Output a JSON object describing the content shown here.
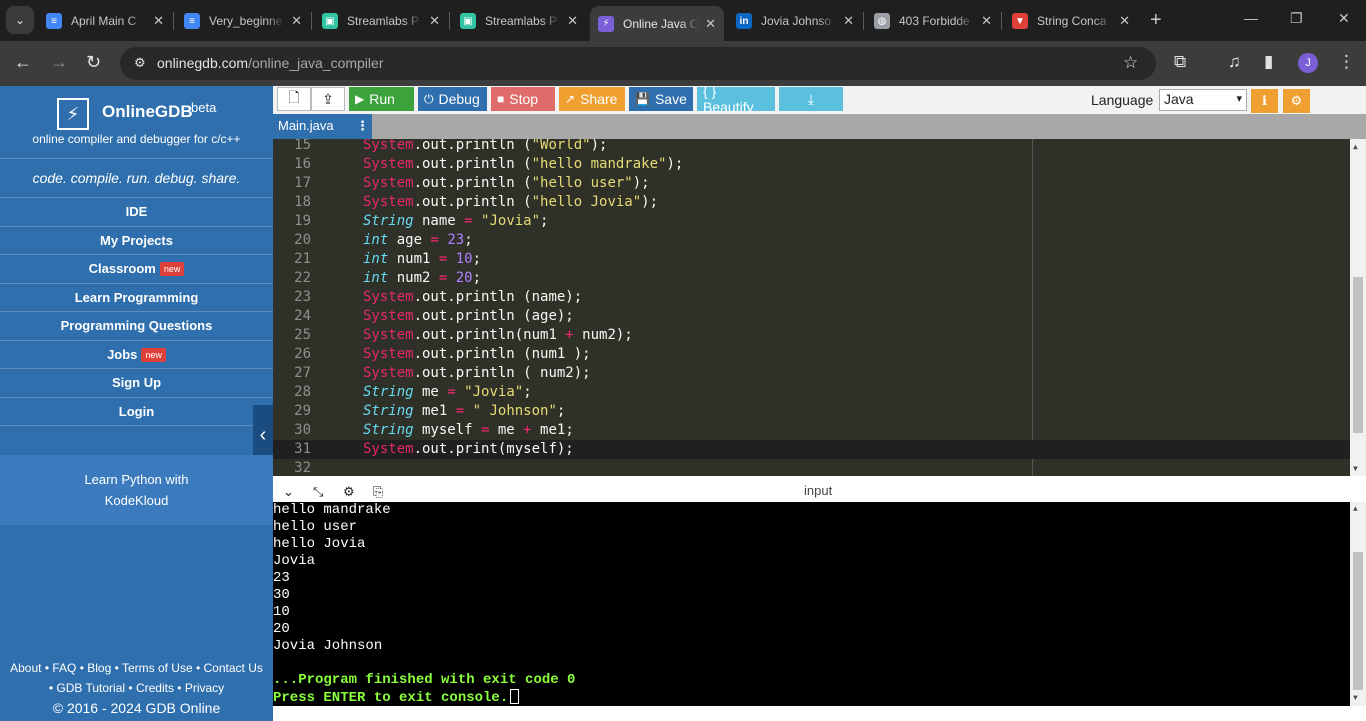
{
  "browser": {
    "tabs": [
      {
        "title": "April Main C",
        "favicon": "docs-icon",
        "color": "#4285f4"
      },
      {
        "title": "Very_beginne",
        "favicon": "docs-icon",
        "color": "#4285f4"
      },
      {
        "title": "Streamlabs P",
        "favicon": "streamlabs-icon",
        "color": "#31c3a2"
      },
      {
        "title": "Streamlabs P",
        "favicon": "streamlabs-icon",
        "color": "#31c3a2"
      },
      {
        "title": "Online Java C",
        "favicon": "onlinegdb-icon",
        "color": "#7b5fd6"
      },
      {
        "title": "Jovia Johnso",
        "favicon": "linkedin-icon",
        "color": "#0a66c2"
      },
      {
        "title": "403 Forbidde",
        "favicon": "globe-icon",
        "color": "#9aa0a6"
      },
      {
        "title": "String Conca",
        "favicon": "vercel-icon",
        "color": "#e0403a"
      }
    ],
    "url_host": "onlinegdb.com",
    "url_path": "/online_java_compiler",
    "avatar_letter": "J"
  },
  "sidebar": {
    "brand": "OnlineGDB",
    "beta": "beta",
    "subtitle": "online compiler and debugger for c/c++",
    "tagline": "code. compile. run. debug. share.",
    "menu": [
      {
        "label": "IDE",
        "new": false
      },
      {
        "label": "My Projects",
        "new": false
      },
      {
        "label": "Classroom",
        "new": true
      },
      {
        "label": "Learn Programming",
        "new": false
      },
      {
        "label": "Programming Questions",
        "new": false
      },
      {
        "label": "Jobs",
        "new": true
      },
      {
        "label": "Sign Up",
        "new": false
      },
      {
        "label": "Login",
        "new": false
      }
    ],
    "new_badge": "new",
    "promo_line1": "Learn Python with",
    "promo_line2": "KodeKloud",
    "footer": {
      "about": "About",
      "faq": "FAQ",
      "blog": "Blog",
      "terms": "Terms of Use",
      "contact": "Contact Us",
      "tutorial": "GDB Tutorial",
      "credits": "Credits",
      "privacy": "Privacy",
      "copyright": "© 2016 - 2024 GDB Online"
    }
  },
  "ide": {
    "run": "Run",
    "debug": "Debug",
    "stop": "Stop",
    "share": "Share",
    "save": "Save",
    "beautify": "{ } Beautify",
    "language_label": "Language",
    "language_value": "Java",
    "file_tab": "Main.java",
    "colors": {
      "run": "#3ca33c",
      "debug": "#2f6fad",
      "stop": "#e06b6b",
      "share": "#f0a030",
      "save": "#2f6fad",
      "beautify": "#5bc0de",
      "download": "#5bc0de"
    }
  },
  "editor": {
    "active_line": 31,
    "lines": [
      {
        "n": "15",
        "html": "<span class='k-sys'>System</span>.out.println (<span class='str'>\"World\"</span>);"
      },
      {
        "n": "16",
        "html": "<span class='k-sys'>System</span>.out.println (<span class='str'>\"hello mandrake\"</span>);"
      },
      {
        "n": "17",
        "html": "<span class='k-sys'>System</span>.out.println (<span class='str'>\"hello user\"</span>);"
      },
      {
        "n": "18",
        "html": "<span class='k-sys'>System</span>.out.println (<span class='str'>\"hello Jovia\"</span>);"
      },
      {
        "n": "19",
        "html": "<span class='k-type'>String</span> name <span class='op'>=</span> <span class='str'>\"Jovia\"</span>;"
      },
      {
        "n": "20",
        "html": "<span class='k-type'>int</span> age <span class='op'>=</span> <span class='num'>23</span>;"
      },
      {
        "n": "21",
        "html": "<span class='k-type'>int</span> num1 <span class='op'>=</span> <span class='num'>10</span>;"
      },
      {
        "n": "22",
        "html": "<span class='k-type'>int</span> num2 <span class='op'>=</span> <span class='num'>20</span>;"
      },
      {
        "n": "23",
        "html": "<span class='k-sys'>System</span>.out.println (name);"
      },
      {
        "n": "24",
        "html": "<span class='k-sys'>System</span>.out.println (age);"
      },
      {
        "n": "25",
        "html": "<span class='k-sys'>System</span>.out.println(num1 <span class='op'>+</span> num2);"
      },
      {
        "n": "26",
        "html": "<span class='k-sys'>System</span>.out.println (num1 );"
      },
      {
        "n": "27",
        "html": "<span class='k-sys'>System</span>.out.println ( num2);"
      },
      {
        "n": "28",
        "html": "<span class='k-type'>String</span> me <span class='op'>=</span> <span class='str'>\"Jovia\"</span>;"
      },
      {
        "n": "29",
        "html": "<span class='k-type'>String</span> me1 <span class='op'>=</span> <span class='str'>\" Johnson\"</span>;"
      },
      {
        "n": "30",
        "html": "<span class='k-type'>String</span> myself <span class='op'>=</span> me <span class='op'>+</span> me1;"
      },
      {
        "n": "31",
        "html": "<span class='k-sys'>System</span>.out.print(myself);"
      },
      {
        "n": "32",
        "html": ""
      }
    ]
  },
  "console": {
    "title": "input",
    "output": [
      "hello mandrake",
      "hello user",
      "hello Jovia",
      "Jovia",
      "23",
      "30",
      "10",
      "20",
      "Jovia Johnson",
      ""
    ],
    "finished": "...Program finished with exit code 0",
    "prompt": "Press ENTER to exit console."
  }
}
